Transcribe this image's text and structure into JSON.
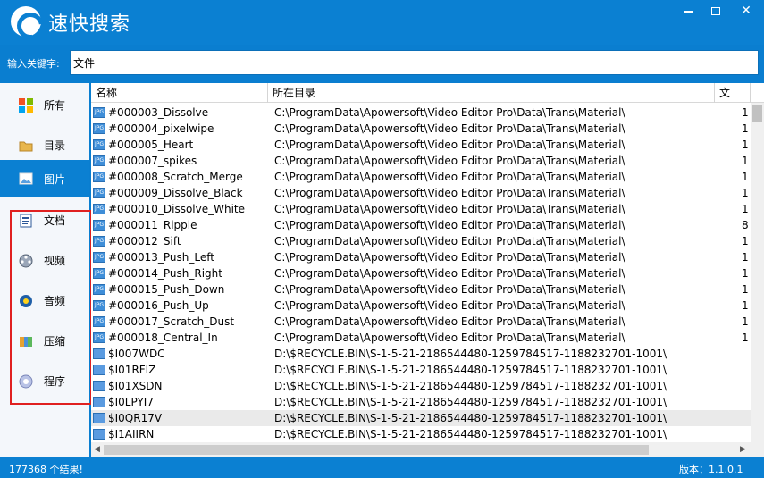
{
  "app": {
    "title": "速快搜索"
  },
  "search": {
    "label": "输入关键字:",
    "value": "文件"
  },
  "sidebar": {
    "items": [
      {
        "label": "所有",
        "icon": "grid-icon"
      },
      {
        "label": "目录",
        "icon": "folder-icon"
      },
      {
        "label": "图片",
        "icon": "picture-icon"
      },
      {
        "label": "文档",
        "icon": "document-icon"
      },
      {
        "label": "视频",
        "icon": "film-reel-icon"
      },
      {
        "label": "音频",
        "icon": "audio-icon"
      },
      {
        "label": "压缩",
        "icon": "archive-icon"
      },
      {
        "label": "程序",
        "icon": "program-icon"
      }
    ],
    "active_index": 2
  },
  "table": {
    "columns": [
      "名称",
      "所在目录",
      "文"
    ],
    "rows": [
      {
        "name": "#000003_Dissolve",
        "dir": "C:\\ProgramData\\Apowersoft\\Video Editor Pro\\Data\\Trans\\Material\\",
        "type": "1"
      },
      {
        "name": "#000004_pixelwipe",
        "dir": "C:\\ProgramData\\Apowersoft\\Video Editor Pro\\Data\\Trans\\Material\\",
        "type": "1"
      },
      {
        "name": "#000005_Heart",
        "dir": "C:\\ProgramData\\Apowersoft\\Video Editor Pro\\Data\\Trans\\Material\\",
        "type": "1"
      },
      {
        "name": "#000007_spikes",
        "dir": "C:\\ProgramData\\Apowersoft\\Video Editor Pro\\Data\\Trans\\Material\\",
        "type": "1"
      },
      {
        "name": "#000008_Scratch_Merge",
        "dir": "C:\\ProgramData\\Apowersoft\\Video Editor Pro\\Data\\Trans\\Material\\",
        "type": "1"
      },
      {
        "name": "#000009_Dissolve_Black",
        "dir": "C:\\ProgramData\\Apowersoft\\Video Editor Pro\\Data\\Trans\\Material\\",
        "type": "1"
      },
      {
        "name": "#000010_Dissolve_White",
        "dir": "C:\\ProgramData\\Apowersoft\\Video Editor Pro\\Data\\Trans\\Material\\",
        "type": "1"
      },
      {
        "name": "#000011_Ripple",
        "dir": "C:\\ProgramData\\Apowersoft\\Video Editor Pro\\Data\\Trans\\Material\\",
        "type": "8"
      },
      {
        "name": "#000012_Sift",
        "dir": "C:\\ProgramData\\Apowersoft\\Video Editor Pro\\Data\\Trans\\Material\\",
        "type": "1"
      },
      {
        "name": "#000013_Push_Left",
        "dir": "C:\\ProgramData\\Apowersoft\\Video Editor Pro\\Data\\Trans\\Material\\",
        "type": "1"
      },
      {
        "name": "#000014_Push_Right",
        "dir": "C:\\ProgramData\\Apowersoft\\Video Editor Pro\\Data\\Trans\\Material\\",
        "type": "1"
      },
      {
        "name": "#000015_Push_Down",
        "dir": "C:\\ProgramData\\Apowersoft\\Video Editor Pro\\Data\\Trans\\Material\\",
        "type": "1"
      },
      {
        "name": "#000016_Push_Up",
        "dir": "C:\\ProgramData\\Apowersoft\\Video Editor Pro\\Data\\Trans\\Material\\",
        "type": "1"
      },
      {
        "name": "#000017_Scratch_Dust",
        "dir": "C:\\ProgramData\\Apowersoft\\Video Editor Pro\\Data\\Trans\\Material\\",
        "type": "1"
      },
      {
        "name": "#000018_Central_In",
        "dir": "C:\\ProgramData\\Apowersoft\\Video Editor Pro\\Data\\Trans\\Material\\",
        "type": "1"
      },
      {
        "name": "$I007WDC",
        "dir": "D:\\$RECYCLE.BIN\\S-1-5-21-2186544480-1259784517-1188232701-1001\\",
        "type": ""
      },
      {
        "name": "$I01RFIZ",
        "dir": "D:\\$RECYCLE.BIN\\S-1-5-21-2186544480-1259784517-1188232701-1001\\",
        "type": ""
      },
      {
        "name": "$I01XSDN",
        "dir": "D:\\$RECYCLE.BIN\\S-1-5-21-2186544480-1259784517-1188232701-1001\\",
        "type": ""
      },
      {
        "name": "$I0LPYI7",
        "dir": "D:\\$RECYCLE.BIN\\S-1-5-21-2186544480-1259784517-1188232701-1001\\",
        "type": ""
      },
      {
        "name": "$I0QR17V",
        "dir": "D:\\$RECYCLE.BIN\\S-1-5-21-2186544480-1259784517-1188232701-1001\\",
        "type": ""
      },
      {
        "name": "$I1AIIRN",
        "dir": "D:\\$RECYCLE.BIN\\S-1-5-21-2186544480-1259784517-1188232701-1001\\",
        "type": ""
      }
    ],
    "selected_index": 19
  },
  "status": {
    "count": "177368 个结果!",
    "version": "版本：1.1.0.1"
  },
  "colors": {
    "accent": "#0b80d2",
    "highlight_box": "#e02020"
  }
}
